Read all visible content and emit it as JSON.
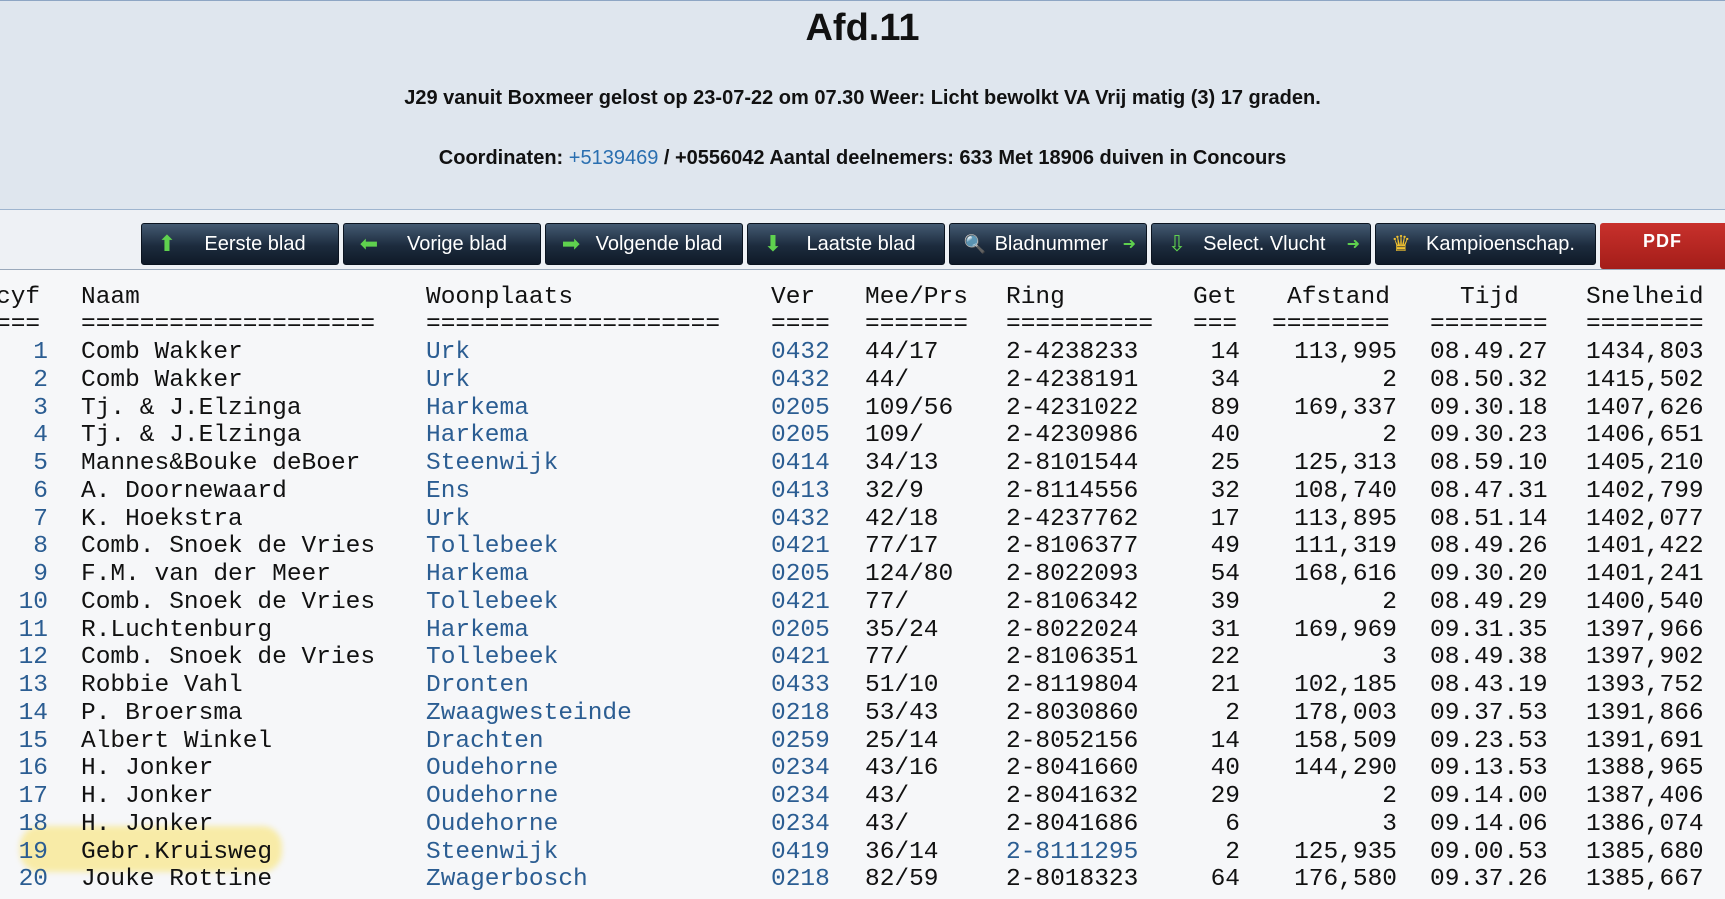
{
  "header": {
    "title": "Afd.11",
    "line1": "J29 vanuit Boxmeer gelost op 23-07-22 om 07.30 Weer: Licht bewolkt VA Vrij matig (3) 17 graden.",
    "line2_prefix": "Coordinaten: ",
    "line2_link": "+5139469",
    "line2_suffix": " / +0556042 Aantal deelnemers: 633 Met 18906 duiven in Concours"
  },
  "toolbar": {
    "first": "Eerste blad",
    "prev": "Vorige blad",
    "next": "Volgende blad",
    "last": "Laatste blad",
    "page": "Bladnummer",
    "select": "Select. Vlucht",
    "champ": "Kampioenschap.",
    "pdf": "PDF"
  },
  "table": {
    "headers": {
      "rank": "cyf",
      "name": "Naam",
      "place": "Woonplaats",
      "ver": "Ver",
      "meeprs": "Mee/Prs",
      "ring": "Ring",
      "get": "Get",
      "afstand": "Afstand",
      "tijd": "Tijd",
      "snelheid": "Snelheid"
    },
    "separators": {
      "rank": "===",
      "name": "====================",
      "place": "====================",
      "ver": "====",
      "meeprs": "=======",
      "ring": "==========",
      "get": "===",
      "afstand": "========",
      "tijd": "========",
      "snelheid": "========"
    },
    "rows": [
      {
        "rank": "1",
        "name": "Comb Wakker",
        "place": "Urk",
        "ver": "0432",
        "meeprs": "44/17",
        "ring": "2-4238233",
        "get": "14",
        "afstand": "113,995",
        "tijd": "08.49.27",
        "snelheid": "1434,803"
      },
      {
        "rank": "2",
        "name": "Comb Wakker",
        "place": "Urk",
        "ver": "0432",
        "meeprs": "44/",
        "ring": "2-4238191",
        "get": "34",
        "afstand": "2",
        "tijd": "08.50.32",
        "snelheid": "1415,502"
      },
      {
        "rank": "3",
        "name": "Tj. & J.Elzinga",
        "place": "Harkema",
        "ver": "0205",
        "meeprs": "109/56",
        "ring": "2-4231022",
        "get": "89",
        "afstand": "169,337",
        "tijd": "09.30.18",
        "snelheid": "1407,626"
      },
      {
        "rank": "4",
        "name": "Tj. & J.Elzinga",
        "place": "Harkema",
        "ver": "0205",
        "meeprs": "109/",
        "ring": "2-4230986",
        "get": "40",
        "afstand": "2",
        "tijd": "09.30.23",
        "snelheid": "1406,651"
      },
      {
        "rank": "5",
        "name": "Mannes&Bouke deBoer",
        "place": "Steenwijk",
        "ver": "0414",
        "meeprs": "34/13",
        "ring": "2-8101544",
        "get": "25",
        "afstand": "125,313",
        "tijd": "08.59.10",
        "snelheid": "1405,210"
      },
      {
        "rank": "6",
        "name": "A. Doornewaard",
        "place": "Ens",
        "ver": "0413",
        "meeprs": "32/9",
        "ring": "2-8114556",
        "get": "32",
        "afstand": "108,740",
        "tijd": "08.47.31",
        "snelheid": "1402,799"
      },
      {
        "rank": "7",
        "name": "K. Hoekstra",
        "place": "Urk",
        "ver": "0432",
        "meeprs": "42/18",
        "ring": "2-4237762",
        "get": "17",
        "afstand": "113,895",
        "tijd": "08.51.14",
        "snelheid": "1402,077"
      },
      {
        "rank": "8",
        "name": "Comb. Snoek de Vries",
        "place": "Tollebeek",
        "ver": "0421",
        "meeprs": "77/17",
        "ring": "2-8106377",
        "get": "49",
        "afstand": "111,319",
        "tijd": "08.49.26",
        "snelheid": "1401,422"
      },
      {
        "rank": "9",
        "name": "F.M. van der Meer",
        "place": "Harkema",
        "ver": "0205",
        "meeprs": "124/80",
        "ring": "2-8022093",
        "get": "54",
        "afstand": "168,616",
        "tijd": "09.30.20",
        "snelheid": "1401,241"
      },
      {
        "rank": "10",
        "name": "Comb. Snoek de Vries",
        "place": "Tollebeek",
        "ver": "0421",
        "meeprs": "77/",
        "ring": "2-8106342",
        "get": "39",
        "afstand": "2",
        "tijd": "08.49.29",
        "snelheid": "1400,540"
      },
      {
        "rank": "11",
        "name": "R.Luchtenburg",
        "place": "Harkema",
        "ver": "0205",
        "meeprs": "35/24",
        "ring": "2-8022024",
        "get": "31",
        "afstand": "169,969",
        "tijd": "09.31.35",
        "snelheid": "1397,966"
      },
      {
        "rank": "12",
        "name": "Comb. Snoek de Vries",
        "place": "Tollebeek",
        "ver": "0421",
        "meeprs": "77/",
        "ring": "2-8106351",
        "get": "22",
        "afstand": "3",
        "tijd": "08.49.38",
        "snelheid": "1397,902"
      },
      {
        "rank": "13",
        "name": "Robbie Vahl",
        "place": "Dronten",
        "ver": "0433",
        "meeprs": "51/10",
        "ring": "2-8119804",
        "get": "21",
        "afstand": "102,185",
        "tijd": "08.43.19",
        "snelheid": "1393,752"
      },
      {
        "rank": "14",
        "name": "P. Broersma",
        "place": "Zwaagwesteinde",
        "ver": "0218",
        "meeprs": "53/43",
        "ring": "2-8030860",
        "get": "2",
        "afstand": "178,003",
        "tijd": "09.37.53",
        "snelheid": "1391,866"
      },
      {
        "rank": "15",
        "name": "Albert Winkel",
        "place": "Drachten",
        "ver": "0259",
        "meeprs": "25/14",
        "ring": "2-8052156",
        "get": "14",
        "afstand": "158,509",
        "tijd": "09.23.53",
        "snelheid": "1391,691"
      },
      {
        "rank": "16",
        "name": "H. Jonker",
        "place": "Oudehorne",
        "ver": "0234",
        "meeprs": "43/16",
        "ring": "2-8041660",
        "get": "40",
        "afstand": "144,290",
        "tijd": "09.13.53",
        "snelheid": "1388,965"
      },
      {
        "rank": "17",
        "name": "H. Jonker",
        "place": "Oudehorne",
        "ver": "0234",
        "meeprs": "43/",
        "ring": "2-8041632",
        "get": "29",
        "afstand": "2",
        "tijd": "09.14.00",
        "snelheid": "1387,406"
      },
      {
        "rank": "18",
        "name": "H. Jonker",
        "place": "Oudehorne",
        "ver": "0234",
        "meeprs": "43/",
        "ring": "2-8041686",
        "get": "6",
        "afstand": "3",
        "tijd": "09.14.06",
        "snelheid": "1386,074"
      },
      {
        "rank": "19",
        "name": "Gebr.Kruisweg",
        "place": "Steenwijk",
        "ver": "0419",
        "meeprs": "36/14",
        "ring": "2-8111295",
        "ring_link": true,
        "get": "2",
        "afstand": "125,935",
        "tijd": "09.00.53",
        "snelheid": "1385,680"
      },
      {
        "rank": "20",
        "name": "Jouke Rottine",
        "place": "Zwagerbosch",
        "ver": "0218",
        "meeprs": "82/59",
        "ring": "2-8018323",
        "get": "64",
        "afstand": "176,580",
        "tijd": "09.37.26",
        "snelheid": "1385,667"
      }
    ]
  }
}
